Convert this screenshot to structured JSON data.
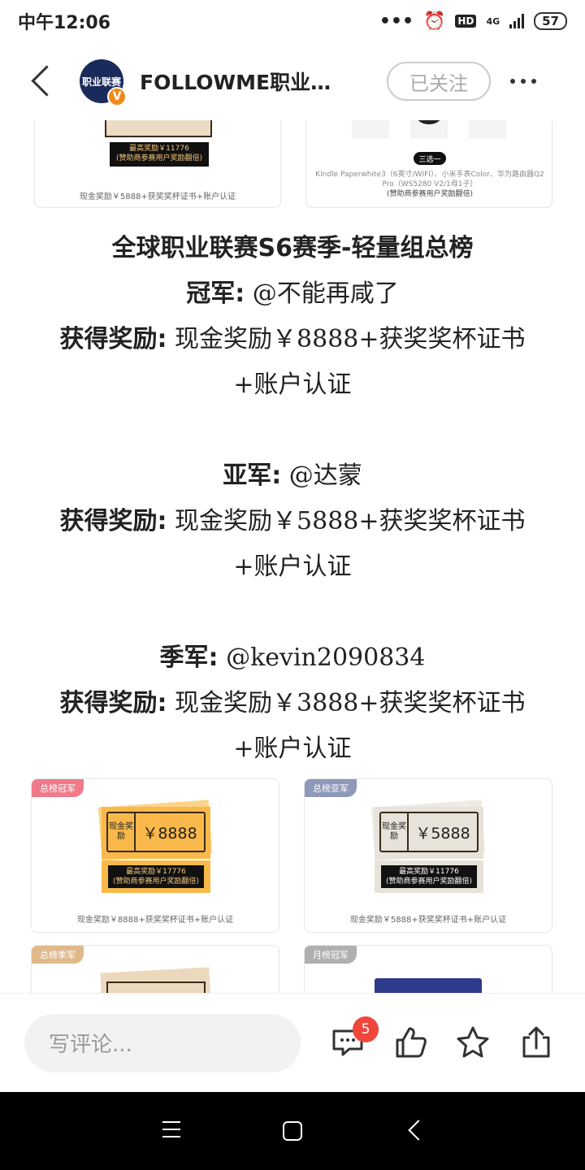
{
  "status": {
    "time": "中午12:06",
    "network": "4G",
    "hd": "HD",
    "battery": "57"
  },
  "header": {
    "account_name": "FOLLOWME职业…",
    "follow_label": "已关注",
    "avatar_text": "职业联赛",
    "avatar_badge": "V"
  },
  "top_cards": {
    "left": {
      "bar_line1": "最高奖励￥11776",
      "bar_line2": "(赞助商参赛用户奖励翻倍)",
      "note": "现金奖励￥5888+获奖奖杯证书+账户认证"
    },
    "right": {
      "choose_label": "三选一",
      "desc_line1": "Kindle Paperwhite3（6英寸/WIFI）、小米手表Color、华为路由器Q2",
      "desc_line2": "Pro（WS5280 V2/1母1子）",
      "desc_line3": "(赞助商参赛用户奖励翻倍)"
    }
  },
  "article": {
    "title": "全球职业联赛S6赛季-轻量组总榜",
    "champion_label": "冠军:",
    "champion_name": "@不能再咸了",
    "reward_label": "获得奖励:",
    "champion_reward": "现金奖励￥8888+获奖奖杯证书",
    "account_cert": "+账户认证",
    "runnerup_label": "亚军:",
    "runnerup_name": "@达蒙",
    "runnerup_reward": "现金奖励￥5888+获奖奖杯证书",
    "third_label": "季军:",
    "third_name": "@kevin2090834",
    "third_reward": "现金奖励￥3888+获奖奖杯证书"
  },
  "cards": {
    "champion": {
      "tag": "总榜冠军",
      "ticket_left": "现金奖励",
      "ticket_value": "￥8888",
      "bar_line1": "最高奖励￥17776",
      "bar_line2": "(赞助商参赛用户奖励翻倍)",
      "note": "现金奖励￥8888+获奖奖杯证书+账户认证"
    },
    "runnerup": {
      "tag": "总榜亚军",
      "ticket_left": "现金奖励",
      "ticket_value": "￥5888",
      "bar_line1": "最高奖励￥11776",
      "bar_line2": "(赞助商参赛用户奖励翻倍)",
      "note": "现金奖励￥5888+获奖奖杯证书+账户认证"
    },
    "third": {
      "tag": "总榜季军"
    },
    "monthly": {
      "tag": "月榜冠军"
    }
  },
  "bottom": {
    "comment_placeholder": "写评论...",
    "comment_count": "5"
  }
}
